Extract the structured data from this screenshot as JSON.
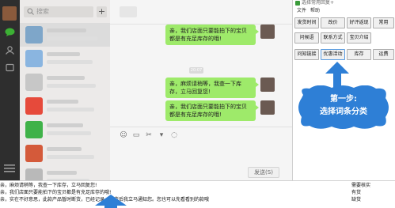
{
  "wechat": {
    "search_placeholder": "搜索",
    "plus_label": "+",
    "time_label": "20:07",
    "send_label": "发送(S)",
    "messages": [
      {
        "text": "亲，我们店面只要能拍下的宝贝都是有充足库存的哦!"
      },
      {
        "text": "亲，麻烦请稍等，我查一下库存，立马回复您!"
      },
      {
        "text": "亲，我们店面只要能拍下的宝贝都是有充足库存的哦!"
      }
    ],
    "tool_icons": [
      "☺",
      "▭",
      "✂",
      "▾",
      "◌"
    ]
  },
  "tool": {
    "title": "选择常用回复+",
    "menus": [
      "文件",
      "帮助"
    ],
    "buttons": [
      {
        "label": "发货时间"
      },
      {
        "label": "改价"
      },
      {
        "label": "好评返现"
      },
      {
        "label": "常用"
      },
      {
        "label": "问候语"
      },
      {
        "label": "联系方式"
      },
      {
        "label": "宝贝介绍"
      },
      {
        "label": "问知链接"
      },
      {
        "label": "优惠活动"
      },
      {
        "label": "库存"
      },
      {
        "label": "运费"
      }
    ]
  },
  "annotation": {
    "line1": "第一步:",
    "line2": "选择词条分类",
    "color": "#2e7fd6"
  },
  "replies": [
    {
      "text": "亲，麻烦请稍等，我查一下库存，立马回复您!",
      "status": "需要核实"
    },
    {
      "text": "亲，我们店面只要能拍下的宝贝都是有充足库存的哦!",
      "status": "有货"
    },
    {
      "text": "亲，实在不好意思，此款产品暂时断货，已经记录，到货后我立马通知您。您也可以先看看别的款哦",
      "status": "缺货"
    }
  ]
}
